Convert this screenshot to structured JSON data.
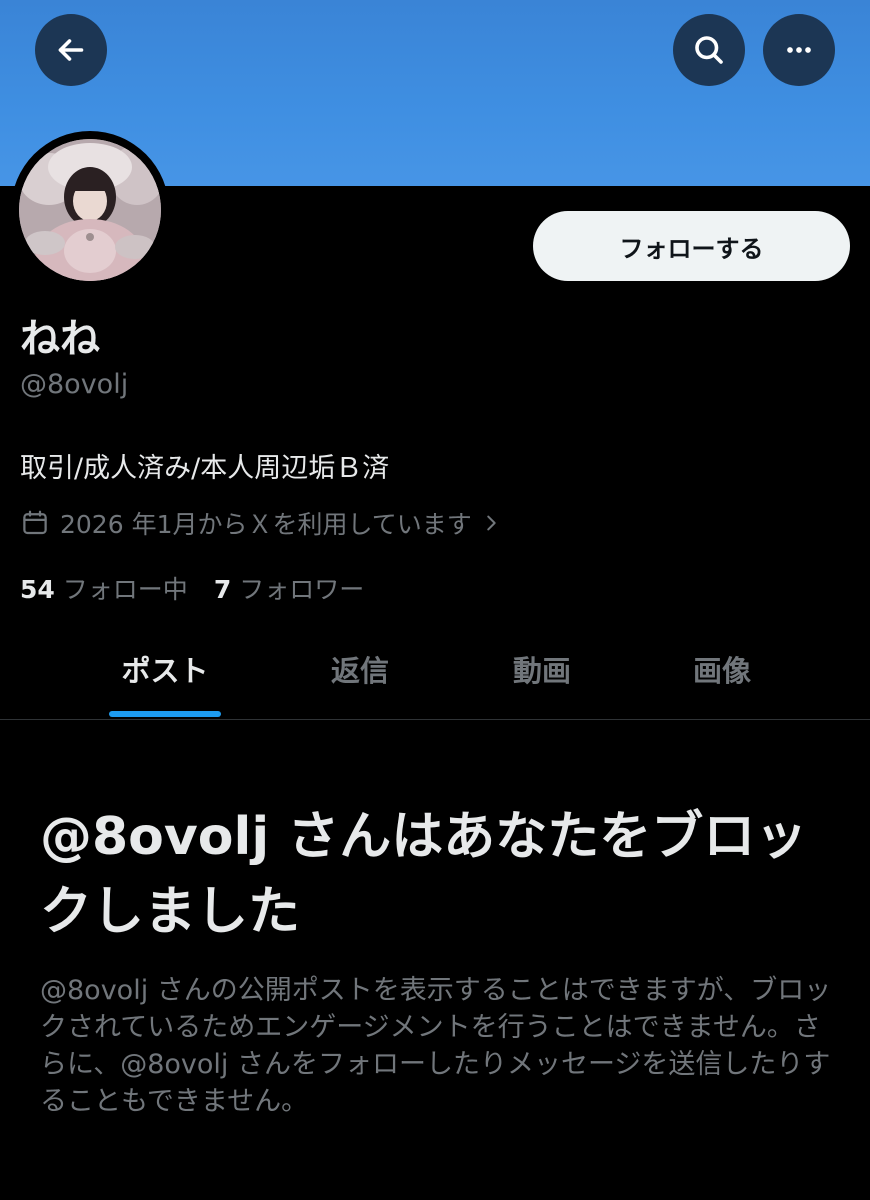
{
  "header": {
    "back_icon": "arrow-left-icon",
    "search_icon": "search-icon",
    "more_icon": "more-horizontal-icon",
    "banner_color": "#3f8fe2"
  },
  "profile": {
    "display_name": "ねね",
    "handle": "@8ovolj",
    "bio": "取引/成人済み/本人周辺垢Ｂ済",
    "joined": "2026 年1月からＸを利用しています",
    "follow_label": "フォローする",
    "following_count": "54",
    "following_label": "フォロー中",
    "followers_count": "7",
    "followers_label": "フォロワー"
  },
  "tabs": [
    {
      "label": "ポスト",
      "active": true
    },
    {
      "label": "返信",
      "active": false
    },
    {
      "label": "動画",
      "active": false
    },
    {
      "label": "画像",
      "active": false
    }
  ],
  "blocked": {
    "title": "@8ovolj さんはあなたをブロックしました",
    "body": "@8ovolj さんの公開ポストを表示することはできますが、ブロックされているためエンゲージメントを行うことはできません。さらに、@8ovolj さんをフォローしたりメッセージを送信したりすることもできません。"
  },
  "colors": {
    "accent": "#1d9bf0",
    "text_primary": "#e7e9ea",
    "text_secondary": "#71767b",
    "background": "#000000"
  }
}
